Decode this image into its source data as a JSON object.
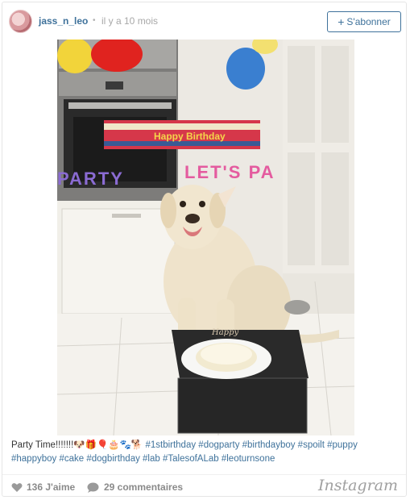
{
  "header": {
    "username": "jass_n_leo",
    "separator": "•",
    "time": "il y a 10 mois",
    "follow_label": "S'abonner",
    "follow_icon": "+"
  },
  "photo": {
    "banner_text": "Happy Birthday",
    "letters_left": "PARTY",
    "letters_right": "LET'S PA",
    "topper_text": "Happy"
  },
  "caption": {
    "text": "Party Time!!!!!!!🐶🎁🎈🎂🐾🐕",
    "hashtags": "#1stbirthday #dogparty #birthdayboy #spoilt #puppy #happyboy #cake #dogbirthday #lab #TalesofALab #leoturnsone"
  },
  "footer": {
    "likes": "136 J'aime",
    "comments": "29 commentaires",
    "brand": "Instagram"
  },
  "colors": {
    "link": "#3f729b",
    "muted": "#a8a8a8"
  }
}
